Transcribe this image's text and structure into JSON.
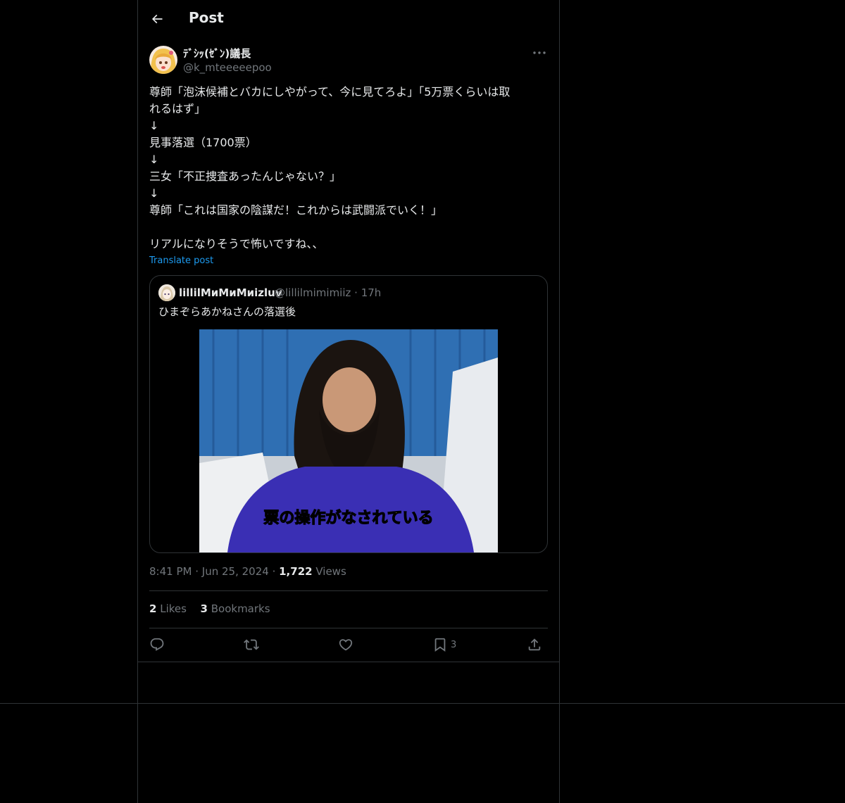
{
  "header": {
    "title": "Post"
  },
  "post": {
    "author_name": "ﾃﾞｼｯ(ｾﾞﾝ)議長",
    "author_handle": "@k_mteeeeepoo",
    "lines": [
      "尊師「泡沫候補とバカにしやがって、今に見てろよ」「5万票くらいは取",
      "れるはず」",
      "↓",
      "見事落選（1700票）",
      "↓",
      "三女「不正捜査あったんじゃない？」",
      "↓",
      "尊師「これは国家の陰謀だ！これからは武闘派でいく！」",
      "",
      "リアルになりそうで怖いですね、、"
    ],
    "translate_label": "Translate post",
    "time": "8:41 PM",
    "date": "Jun 25, 2024",
    "views_count": "1,722",
    "views_label": "Views",
    "likes_count": "2",
    "likes_label": "Likes",
    "bookmarks_count": "3",
    "bookmarks_label": "Bookmarks",
    "bookmark_action_count": "3"
  },
  "quote": {
    "author_name": "lillilMиMиMиizluv",
    "author_handle": "@lillilmimimiiz",
    "time": "17h",
    "text": "ひまぞらあかねさんの落選後",
    "media_caption": "票の操作がなされている"
  },
  "colors": {
    "background": "#000000",
    "border": "#2f3336",
    "text_primary": "#e7e9ea",
    "text_secondary": "#71767b",
    "accent": "#1d9bf0"
  },
  "icons": [
    "back-arrow-icon",
    "more-icon",
    "reply-icon",
    "repost-icon",
    "like-icon",
    "bookmark-icon",
    "share-icon"
  ]
}
